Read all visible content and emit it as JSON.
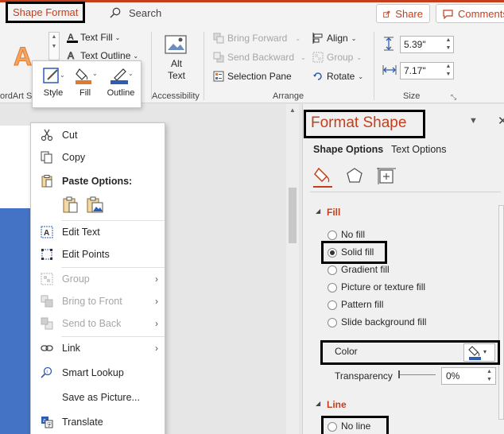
{
  "topbar": {
    "tab_label": "Shape Format",
    "search_placeholder": "Search",
    "share_label": "Share",
    "comments_label": "Comments"
  },
  "ribbon": {
    "text_fill": "Text Fill",
    "text_outline": "Text Outline",
    "wordart_group": "ordArt S",
    "alt_text_line1": "Alt",
    "alt_text_line2": "Text",
    "accessibility_group": "Accessibility",
    "bring_forward": "Bring Forward",
    "send_backward": "Send Backward",
    "selection_pane": "Selection Pane",
    "align": "Align",
    "group": "Group",
    "rotate": "Rotate",
    "arrange_group": "Arrange",
    "height_value": "5.39\"",
    "width_value": "7.17\"",
    "size_group": "Size"
  },
  "style_popup": {
    "style": "Style",
    "fill": "Fill",
    "outline": "Outline"
  },
  "context_menu": {
    "cut": "Cut",
    "copy": "Copy",
    "paste_options": "Paste Options:",
    "edit_text": "Edit Text",
    "edit_points": "Edit Points",
    "group": "Group",
    "bring_to_front": "Bring to Front",
    "send_to_back": "Send to Back",
    "link": "Link",
    "smart_lookup": "Smart Lookup",
    "save_as_picture": "Save as Picture...",
    "translate": "Translate"
  },
  "format_pane": {
    "title": "Format Shape",
    "shape_options": "Shape Options",
    "text_options": "Text Options",
    "fill_section": "Fill",
    "fill_options": [
      "No fill",
      "Solid fill",
      "Gradient fill",
      "Picture or texture fill",
      "Pattern fill",
      "Slide background fill"
    ],
    "selected_fill": "Solid fill",
    "color_label": "Color",
    "transparency_label": "Transparency",
    "transparency_value": "0%",
    "line_section": "Line",
    "line_first_option": "No line"
  },
  "colors": {
    "accent": "#c43e1c",
    "fill_swatch": "#2e5db5",
    "slide_shape": "#4472c4"
  }
}
